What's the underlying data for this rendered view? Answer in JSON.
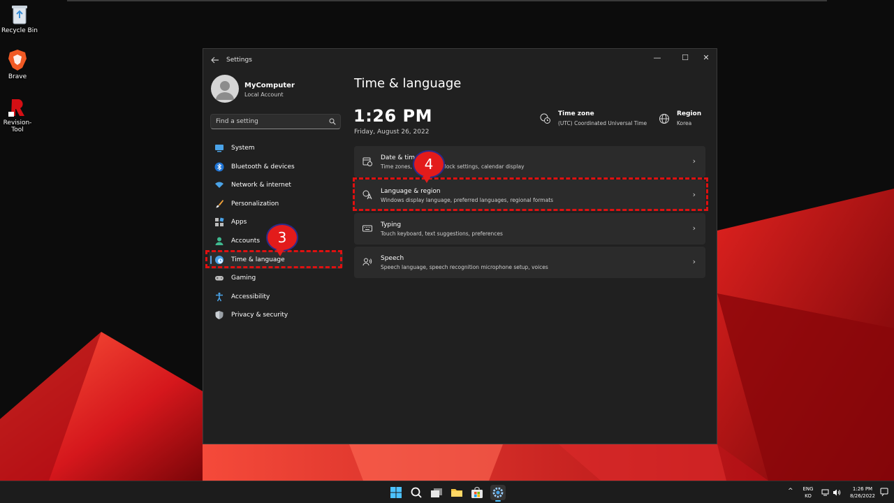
{
  "desktop": {
    "icons": [
      {
        "label": "Recycle Bin"
      },
      {
        "label": "Brave"
      },
      {
        "label": "Revision-Tool"
      }
    ]
  },
  "window": {
    "title": "Settings",
    "back_icon": "back-arrow-icon",
    "controls": {
      "minimize": "—",
      "maximize": "☐",
      "close": "✕"
    }
  },
  "account": {
    "name": "MyComputer",
    "type": "Local Account"
  },
  "search": {
    "placeholder": "Find a setting"
  },
  "nav": {
    "items": [
      {
        "label": "System",
        "icon": "system-icon"
      },
      {
        "label": "Bluetooth & devices",
        "icon": "bluetooth-icon"
      },
      {
        "label": "Network & internet",
        "icon": "wifi-icon"
      },
      {
        "label": "Personalization",
        "icon": "brush-icon"
      },
      {
        "label": "Apps",
        "icon": "apps-icon"
      },
      {
        "label": "Accounts",
        "icon": "accounts-icon"
      },
      {
        "label": "Time & language",
        "icon": "globe-clock-icon",
        "active": true
      },
      {
        "label": "Gaming",
        "icon": "gamepad-icon"
      },
      {
        "label": "Accessibility",
        "icon": "accessibility-icon"
      },
      {
        "label": "Privacy & security",
        "icon": "shield-icon"
      }
    ]
  },
  "main": {
    "title": "Time & language",
    "clock": {
      "time": "1:26 PM",
      "date": "Friday, August 26, 2022"
    },
    "timezone": {
      "title": "Time zone",
      "value": "(UTC) Coordinated Universal Time"
    },
    "region": {
      "title": "Region",
      "value": "Korea"
    },
    "cards": [
      {
        "title": "Date & time",
        "desc": "Time zones, automatic clock settings, calendar display",
        "icon": "calendar-clock-icon"
      },
      {
        "title": "Language & region",
        "desc": "Windows display language, preferred languages, regional formats",
        "icon": "language-icon"
      },
      {
        "title": "Typing",
        "desc": "Touch keyboard, text suggestions, preferences",
        "icon": "keyboard-icon"
      },
      {
        "title": "Speech",
        "desc": "Speech language, speech recognition microphone setup, voices",
        "icon": "speech-icon"
      }
    ],
    "chevron": "›"
  },
  "annotations": {
    "step3": "3",
    "step4": "4",
    "color": "#e01010"
  },
  "taskbar": {
    "lang_line1": "ENG",
    "lang_line2": "KO",
    "time": "1:26 PM",
    "date": "8/26/2022",
    "chevron_up": "^"
  },
  "colors": {
    "accent": "#5aa3e6",
    "window_bg": "#202020",
    "card_bg": "#2b2b2b",
    "wallpaper_red": "#c8141a"
  }
}
